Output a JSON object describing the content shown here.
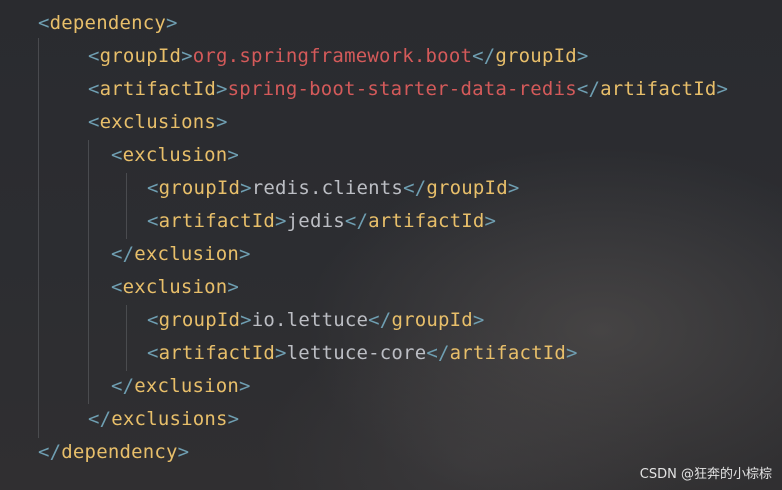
{
  "editor": {
    "lines": [
      {
        "open": "<",
        "tag": "dependency",
        "close": ">"
      },
      {
        "open": "<",
        "tag": "groupId",
        "close": ">",
        "value": "org.springframework.boot",
        "end_open": "</",
        "end_tag": "groupId",
        "end_close": ">"
      },
      {
        "open": "<",
        "tag": "artifactId",
        "close": ">",
        "value": "spring-boot-starter-data-redis",
        "end_open": "</",
        "end_tag": "artifactId",
        "end_close": ">"
      },
      {
        "open": "<",
        "tag": "exclusions",
        "close": ">"
      },
      {
        "open": "<",
        "tag": "exclusion",
        "close": ">"
      },
      {
        "open": "<",
        "tag": "groupId",
        "close": ">",
        "value": "redis.clients",
        "end_open": "</",
        "end_tag": "groupId",
        "end_close": ">"
      },
      {
        "open": "<",
        "tag": "artifactId",
        "close": ">",
        "value": "jedis",
        "end_open": "</",
        "end_tag": "artifactId",
        "end_close": ">"
      },
      {
        "open": "</",
        "tag": "exclusion",
        "close": ">"
      },
      {
        "open": "<",
        "tag": "exclusion",
        "close": ">"
      },
      {
        "open": "<",
        "tag": "groupId",
        "close": ">",
        "value": "io.lettuce",
        "end_open": "</",
        "end_tag": "groupId",
        "end_close": ">"
      },
      {
        "open": "<",
        "tag": "artifactId",
        "close": ">",
        "value": "lettuce-core",
        "end_open": "</",
        "end_tag": "artifactId",
        "end_close": ">"
      },
      {
        "open": "</",
        "tag": "exclusion",
        "close": ">"
      },
      {
        "open": "</",
        "tag": "exclusions",
        "close": ">"
      },
      {
        "open": "</",
        "tag": "dependency",
        "close": ">"
      }
    ]
  },
  "colors": {
    "background": "#2b2c30",
    "bracket": "#6f9fb2",
    "tag_name": "#e8bf6a",
    "text_value": "#bcbec4",
    "highlight_value": "#d45a5a"
  },
  "watermark": "CSDN @狂奔的小棕棕"
}
